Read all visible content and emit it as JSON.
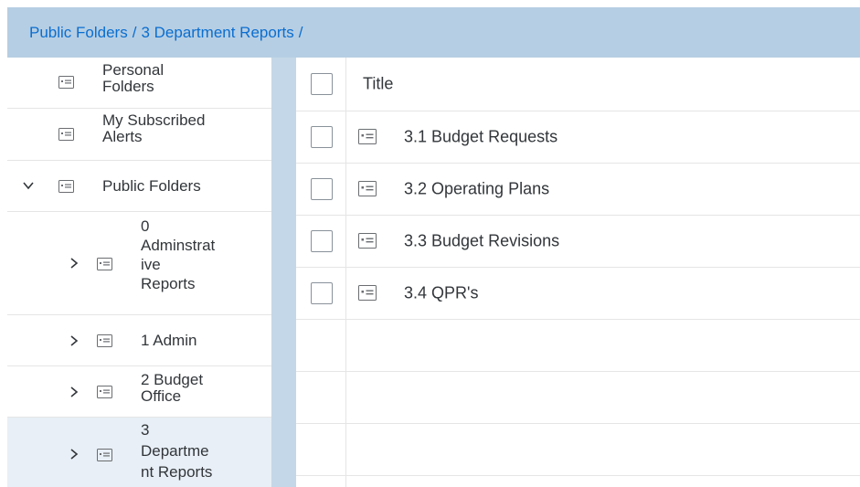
{
  "breadcrumb": {
    "items": [
      "Public Folders",
      "3 Department Reports"
    ],
    "separator": "/"
  },
  "sidebar": {
    "items": [
      {
        "label_lines": [
          "Personal",
          "Folders"
        ],
        "icon": "folder-icon"
      },
      {
        "label_lines": [
          "My Subscribed",
          "Alerts"
        ],
        "icon": "folder-icon"
      },
      {
        "label_lines": [
          "Public Folders"
        ],
        "icon": "folder-icon",
        "expanded": true
      },
      {
        "label_lines": [
          "0",
          "Adminstrat",
          "ive",
          "Reports"
        ],
        "icon": "folder-icon",
        "chevron": "chevron-right-icon"
      },
      {
        "label_lines": [
          "1 Admin"
        ],
        "icon": "folder-icon",
        "chevron": "chevron-right-icon"
      },
      {
        "label_lines": [
          "2 Budget",
          "Office"
        ],
        "icon": "folder-icon",
        "chevron": "chevron-right-icon"
      },
      {
        "label_lines": [
          "3",
          "Departme",
          "nt Reports"
        ],
        "icon": "folder-icon",
        "chevron": "chevron-right-icon",
        "selected": true
      }
    ]
  },
  "table": {
    "header": {
      "title": "Title"
    },
    "rows": [
      {
        "title": "3.1 Budget Requests",
        "icon": "folder-icon"
      },
      {
        "title": "3.2 Operating Plans",
        "icon": "folder-icon"
      },
      {
        "title": "3.3 Budget Revisions",
        "icon": "folder-icon"
      },
      {
        "title": "3.4 QPR's",
        "icon": "folder-icon"
      }
    ]
  },
  "colors": {
    "breadcrumb_bg": "#b6cee3",
    "link": "#0a6ed1",
    "splitter": "#c4d7e8",
    "selected_bg": "#e8eff6",
    "text": "#32363a"
  }
}
